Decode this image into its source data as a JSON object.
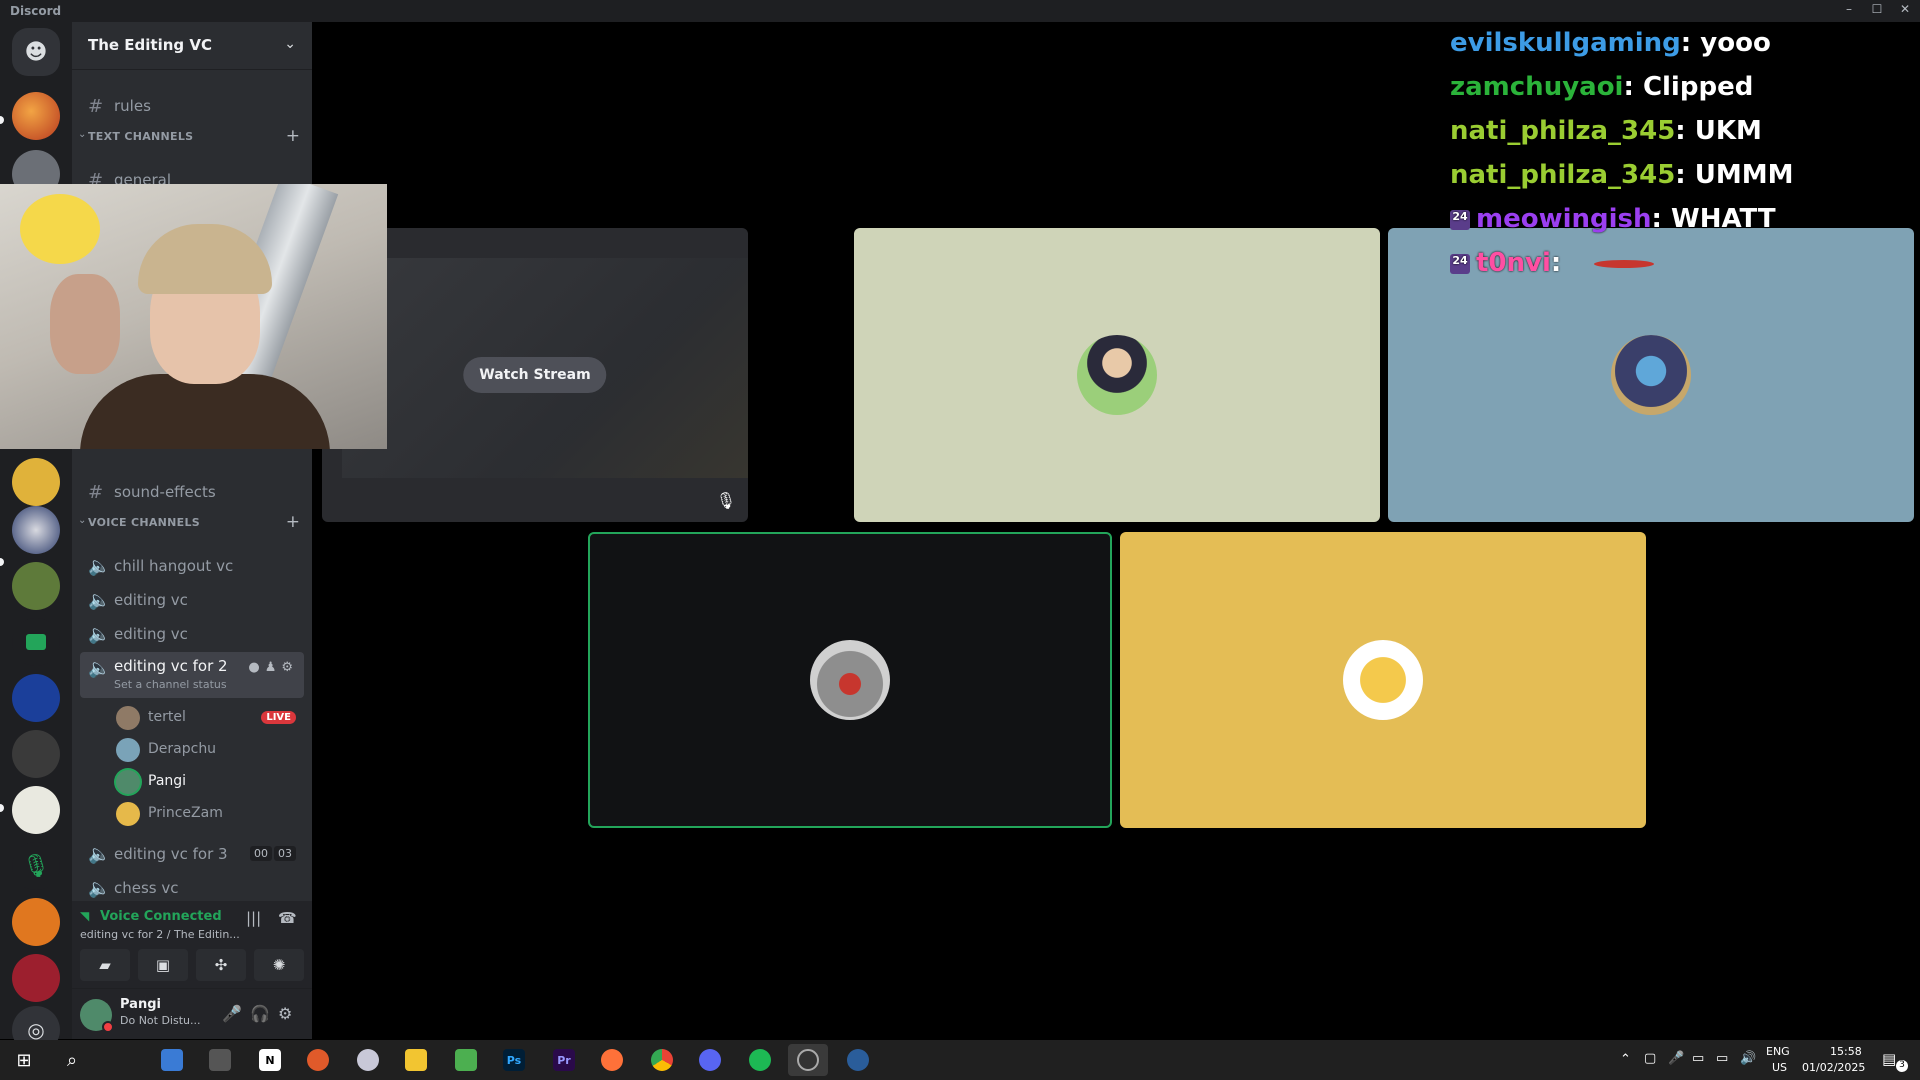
{
  "window": {
    "app_name": "Discord",
    "controls": [
      "–",
      "☐",
      "✕"
    ]
  },
  "server": {
    "name": "The Editing VC"
  },
  "channels": {
    "rules": "rules",
    "text_category": "TEXT CHANNELS",
    "general": "general",
    "sound_effects": "sound-effects",
    "voice_category": "VOICE CHANNELS",
    "voice": [
      {
        "label": "chill hangout vc"
      },
      {
        "label": "editing vc"
      },
      {
        "label": "editing vc"
      }
    ],
    "active_voice": {
      "label": "editing vc for 2",
      "status": "Set a channel status"
    },
    "voice_users": [
      {
        "name": "tertel",
        "live": "LIVE",
        "avatar_color": "#8f7a66"
      },
      {
        "name": "Derapchu",
        "avatar_color": "#7aa3b8"
      },
      {
        "name": "Pangi",
        "avatar_color": "#4f8a6a"
      },
      {
        "name": "PrinceZam",
        "avatar_color": "#e6b94a"
      }
    ],
    "voice_after": [
      {
        "label": "editing vc for 3",
        "count_a": "00",
        "count_b": "03"
      },
      {
        "label": "chess vc"
      }
    ]
  },
  "voice_panel": {
    "title": "Voice Connected",
    "subtitle": "editing vc for 2 / The Editin..."
  },
  "user_panel": {
    "username": "Pangi",
    "status": "Do Not Distu..."
  },
  "stage": {
    "watch_stream": "Watch Stream",
    "tile_colors": {
      "t2": "#cfd4b8",
      "t3": "#7fa2b4",
      "t4": "#111214",
      "t5": "#e4bd55"
    }
  },
  "chat": [
    {
      "user": "evilskullgaming",
      "sep": ":",
      "msg": "yooo",
      "color": "#3d9ce6"
    },
    {
      "user": "zamchuyaoi",
      "sep": ":",
      "msg": "Clipped",
      "color": "#2bb33a"
    },
    {
      "user": "nati_philza_345",
      "sep": ":",
      "msg": "UKM",
      "color": "#9acd32"
    },
    {
      "user": "nati_philza_345",
      "sep": ":",
      "msg": "UMMM",
      "color": "#9acd32"
    },
    {
      "user": "meowingish",
      "sep": ":",
      "msg": "WHATT",
      "color": "#9b3ff0",
      "badge": "24"
    },
    {
      "user": "t0nvi",
      "sep": ":",
      "msg": "",
      "color": "#ff4fa3",
      "badge": "24"
    }
  ],
  "taskbar": {
    "lang": "ENG",
    "region": "US",
    "time": "15:58",
    "date": "01/02/2025",
    "notif_count": "3",
    "apps": [
      "Ps",
      "Pr",
      "N"
    ]
  }
}
